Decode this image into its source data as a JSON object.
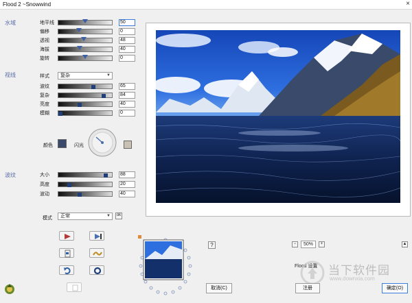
{
  "window": {
    "title": "Flood 2 ~Snowwind",
    "close_glyph": "×"
  },
  "sections": {
    "water": "水域",
    "view": "视线",
    "ripple": "波纹"
  },
  "water_rows": [
    {
      "label": "地平线",
      "value": "50",
      "level": 0.5
    },
    {
      "label": "偏移",
      "value": "0",
      "level": 0.0
    },
    {
      "label": "透视",
      "value": "48",
      "level": 0.48
    },
    {
      "label": "海拔",
      "value": "40",
      "level": 0.4
    },
    {
      "label": "旋转",
      "value": "0",
      "level": 0.0
    }
  ],
  "view": {
    "style_label": "样式",
    "style_value": "复杂",
    "rows": [
      {
        "label": "波纹",
        "value": "65",
        "level": 0.65
      },
      {
        "label": "复杂",
        "value": "84",
        "level": 0.84
      },
      {
        "label": "亮度",
        "value": "40",
        "level": 0.4
      },
      {
        "label": "模糊",
        "value": "0",
        "level": 0.0
      }
    ],
    "color_label": "颜色",
    "glint_label": "闪光"
  },
  "ripple_rows": [
    {
      "label": "大小",
      "value": "88",
      "level": 0.88
    },
    {
      "label": "高度",
      "value": "20",
      "level": 0.2
    },
    {
      "label": "波动",
      "value": "40",
      "level": 0.4
    }
  ],
  "mode": {
    "label": "模式",
    "value": "正常",
    "ok_glyph": "ok"
  },
  "zoom": {
    "minus": "−",
    "value": "50%",
    "plus": "+"
  },
  "help_glyph": "?",
  "up_glyph": "▲",
  "flood_label": "Flood 设置",
  "buttons": {
    "cancel": "取消(C)",
    "register": "注册",
    "ok": "确定(O)"
  },
  "watermark": {
    "brand": "当下软件园",
    "url": "www.downxia.com"
  },
  "colors": {
    "accent": "#3b7ddd",
    "section_label": "#5b6ea8",
    "swatch_dark": "#3b4a6b",
    "swatch_light": "#c9c2b4"
  }
}
